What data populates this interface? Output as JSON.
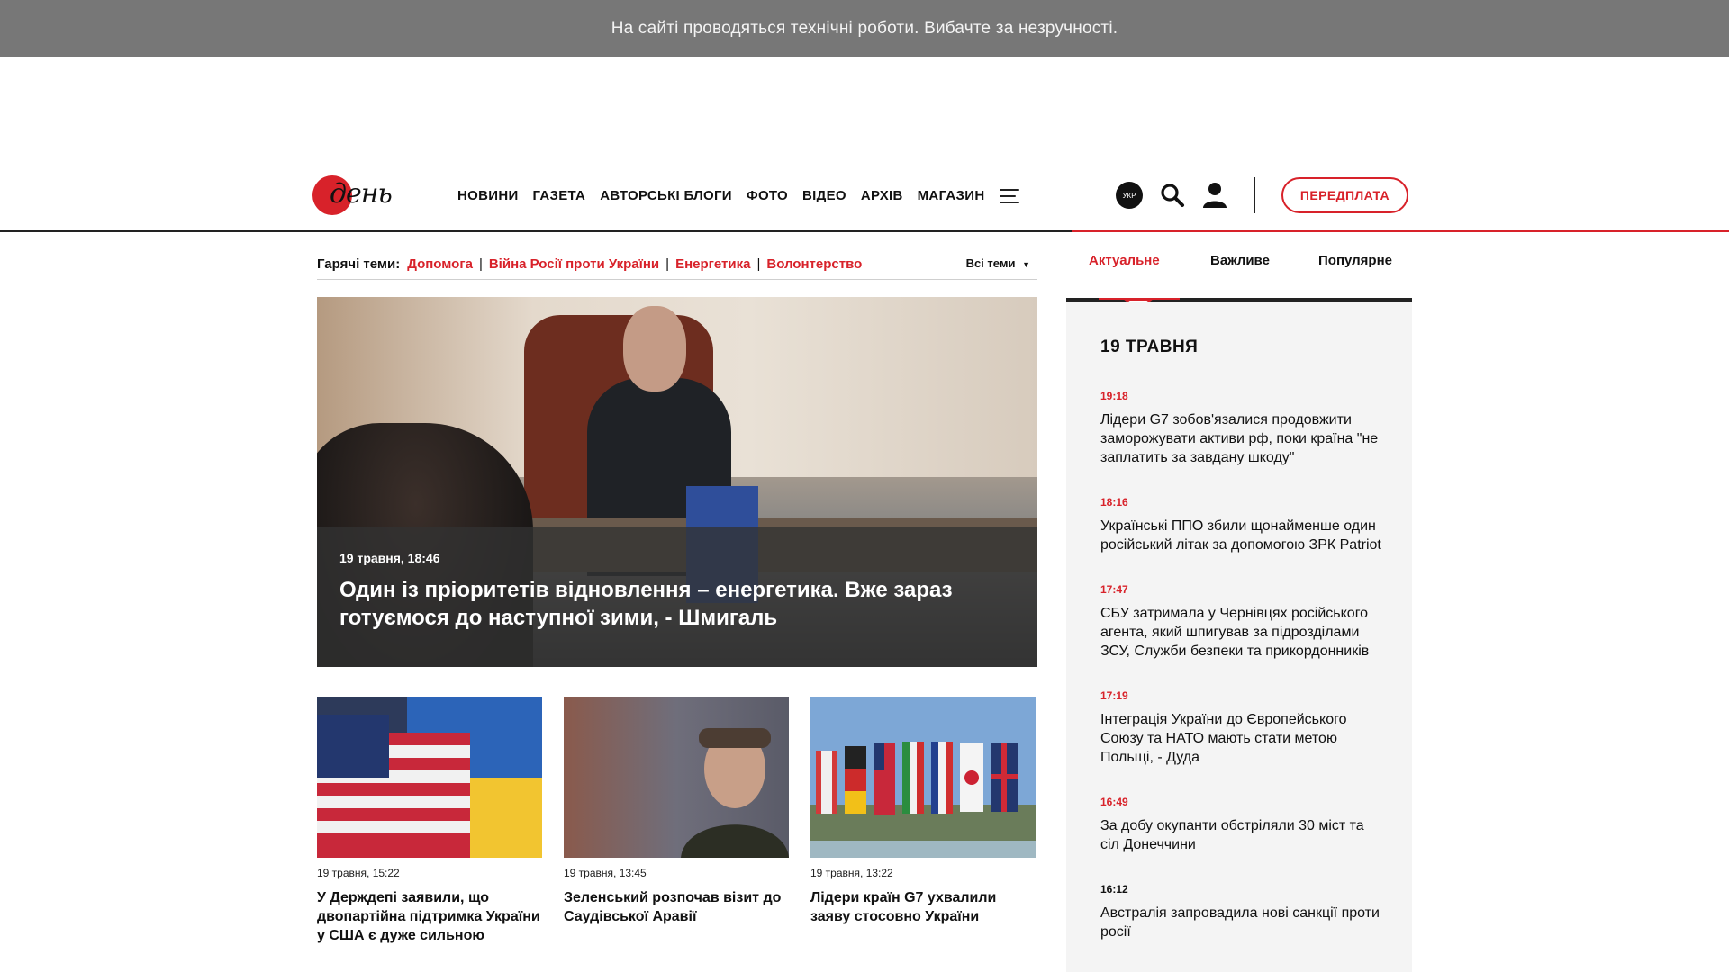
{
  "notice": {
    "text": "На сайті проводяться технічні роботи. Вибачте за незручності."
  },
  "header": {
    "logo_text": "день",
    "nav": [
      "НОВИНИ",
      "ГАЗЕТА",
      "АВТОРСЬКІ БЛОГИ",
      "ФОТО",
      "ВІДЕО",
      "АРХІВ",
      "МАГАЗИН"
    ],
    "lang": "УКР",
    "subscribe_label": "ПЕРЕДПЛАТА",
    "icons": [
      "menu-icon",
      "search-icon",
      "user-icon"
    ],
    "accent": "#d8222a"
  },
  "hot_topics": {
    "label": "Гарячі теми:",
    "topics": [
      "Допомога",
      "Війна Росії проти України",
      "Енергетика",
      "Волонтерство"
    ],
    "all_label": "Всі теми"
  },
  "hero": {
    "date": "19 травня, 18:46",
    "title": "Один із пріоритетів відновлення – енергетика. Вже зараз готуємося до наступної зими, - Шмигаль"
  },
  "cards": [
    {
      "date": "19 травня, 15:22",
      "title": "У Держдепі заявили, що двопартійна підтримка України у США є дуже сильною"
    },
    {
      "date": "19 травня, 13:45",
      "title": "Зеленський розпочав візит до Саудівської Аравії"
    },
    {
      "date": "19 травня, 13:22",
      "title": "Лідери країн G7 ухвалили заяву стосовно України"
    }
  ],
  "sidebar": {
    "tabs": [
      "Актуальне",
      "Важливе",
      "Популярне"
    ],
    "day": "19 ТРАВНЯ",
    "items": [
      {
        "time": "19:18",
        "text": "Лідери G7 зобов'язалися продовжити заморожувати активи рф, поки країна \"не заплатить за завдану шкоду\""
      },
      {
        "time": "18:16",
        "text": "Українські ППО збили щонайменше один російський літак за допомогою ЗРК Patriot"
      },
      {
        "time": "17:47",
        "text": "СБУ затримала у Чернівцях російського агента, який шпигував за підрозділами ЗСУ, Служби безпеки та прикордонників"
      },
      {
        "time": "17:19",
        "text": "Інтеграція України до Європейського Союзу та НАТО мають стати метою Польщі, - Дуда"
      },
      {
        "time": "16:49",
        "text": "За добу окупанти обстріляли 30 міст та сіл Донеччини"
      },
      {
        "time": "16:12",
        "text": "Австралія запровадила нові санкції проти росії"
      }
    ]
  }
}
